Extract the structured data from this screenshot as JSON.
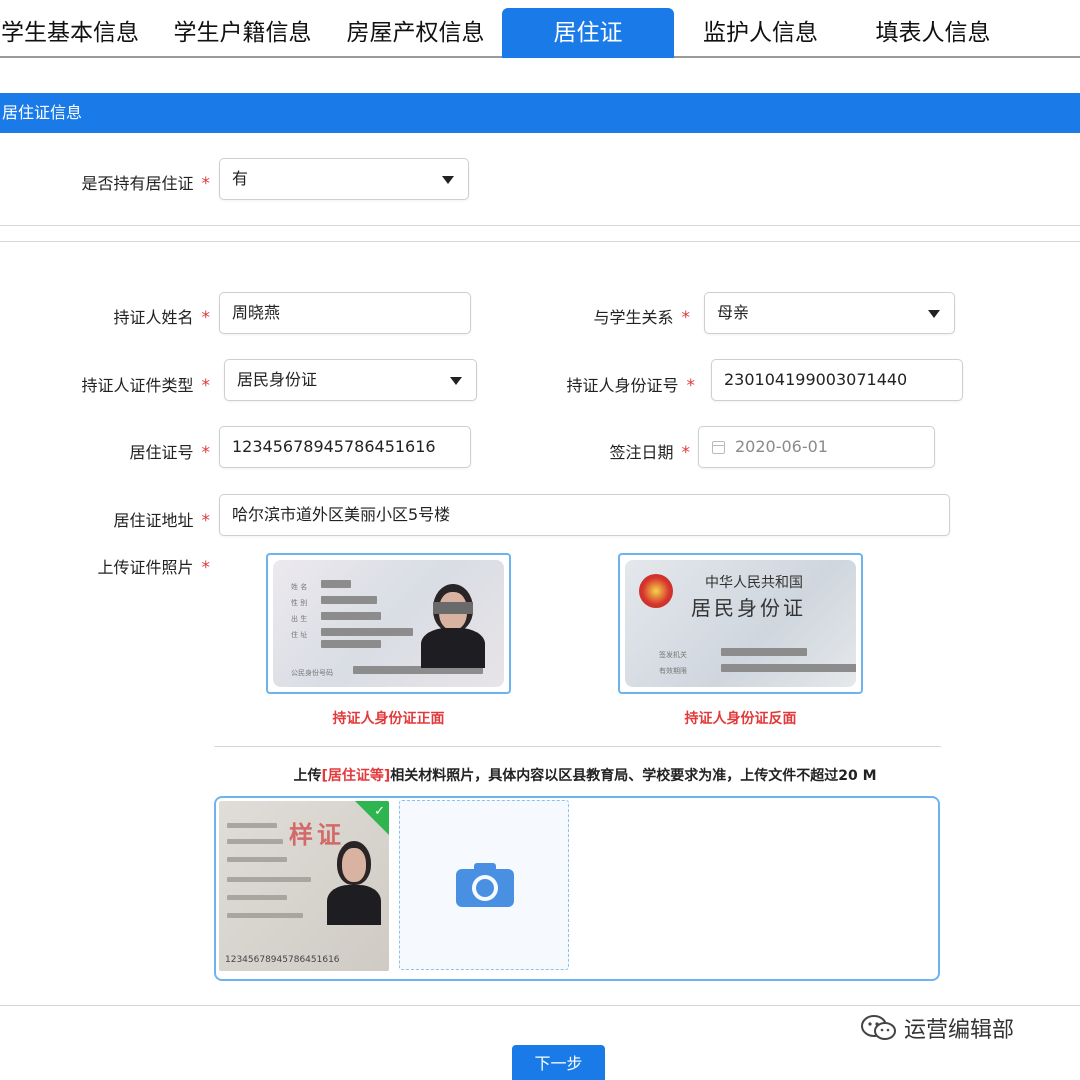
{
  "tabs": [
    {
      "label": "学生基本信息",
      "active": false
    },
    {
      "label": "学生户籍信息",
      "active": false
    },
    {
      "label": "房屋产权信息",
      "active": false
    },
    {
      "label": "居住证",
      "active": true
    },
    {
      "label": "监护人信息",
      "active": false
    },
    {
      "label": "填表人信息",
      "active": false
    }
  ],
  "section_title": "居住证信息",
  "required_mark": "*",
  "has_permit": {
    "label": "是否持有居住证",
    "value": "有"
  },
  "holder_name": {
    "label": "持证人姓名",
    "value": "周晓燕"
  },
  "relation": {
    "label": "与学生关系",
    "value": "母亲"
  },
  "id_type": {
    "label": "持证人证件类型",
    "value": "居民身份证"
  },
  "id_number": {
    "label": "持证人身份证号",
    "value": "230104199003071440"
  },
  "permit_number": {
    "label": "居住证号",
    "value": "12345678945786451616"
  },
  "sign_date": {
    "label": "签注日期",
    "value": "2020-06-01"
  },
  "permit_address": {
    "label": "居住证地址",
    "value": "哈尔滨市道外区美丽小区5号楼"
  },
  "upload_photo": {
    "label": "上传证件照片",
    "front_caption": "持证人身份证正面",
    "back_caption": "持证人身份证反面",
    "back_title_line1": "中华人民共和国",
    "back_title_line2": "居民身份证"
  },
  "materials": {
    "hint_prefix": "上传",
    "hint_highlight": "[居住证等]",
    "hint_suffix": "相关材料照片，具体内容以区县教育局、学校要求为准，上传文件不超过20 M",
    "sample_stamp": "样证",
    "sample_number": "12345678945786451616"
  },
  "next_button": "下一步",
  "watermark": "运营编辑部",
  "colors": {
    "accent": "#1a7be8",
    "required": "#e23a3a",
    "frame": "#6eb3ef",
    "check": "#2fb54f"
  }
}
